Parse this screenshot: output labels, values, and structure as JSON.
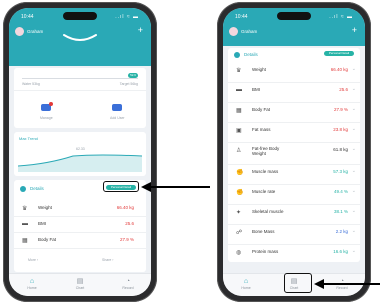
{
  "status": {
    "time": "10:44",
    "icons": "..ıl ≈ ▬"
  },
  "profile": {
    "name": "Graham"
  },
  "summary": {
    "left_label": "Water 53kg",
    "right_label": "Target 56kg",
    "pill": "52.6"
  },
  "shortcuts": [
    {
      "label": "Manage"
    },
    {
      "label": "Add User"
    }
  ],
  "trend": {
    "title": "Max Trend",
    "peak_label": "62.33"
  },
  "details": {
    "title": "Details",
    "pill": "Personal Detail",
    "left_rows": [
      {
        "label": "Weight",
        "value": "66.40 kg"
      },
      {
        "label": "BMI",
        "value": "25.6"
      },
      {
        "label": "Body Fat",
        "value": "27.9 %"
      }
    ],
    "right_rows": [
      {
        "label": "Weight",
        "value": "66.40 kg"
      },
      {
        "label": "BMI",
        "value": "25.6"
      },
      {
        "label": "Body Fat",
        "value": "27.9 %"
      },
      {
        "label": "Fat mass",
        "value": "23.8 kg"
      },
      {
        "label": "Fat-free Body Weight",
        "value": "61.8 kg"
      },
      {
        "label": "Muscle mass",
        "value": "57.3 kg"
      },
      {
        "label": "Muscle rate",
        "value": "49.4 %"
      },
      {
        "label": "Skeletal muscle",
        "value": "38.1 %"
      },
      {
        "label": "Bone Mass",
        "value": "2.2 kg"
      },
      {
        "label": "Protein mass",
        "value": "16.6 kg"
      }
    ]
  },
  "more_links": {
    "left": "More ›",
    "right": "Share ›"
  },
  "tabs": [
    {
      "label": "Home"
    },
    {
      "label": "Chart"
    },
    {
      "label": "Record"
    }
  ],
  "colors": {
    "accent": "#2aa9b6",
    "warning": "#e23a3a",
    "ok": "#27b3a6"
  }
}
